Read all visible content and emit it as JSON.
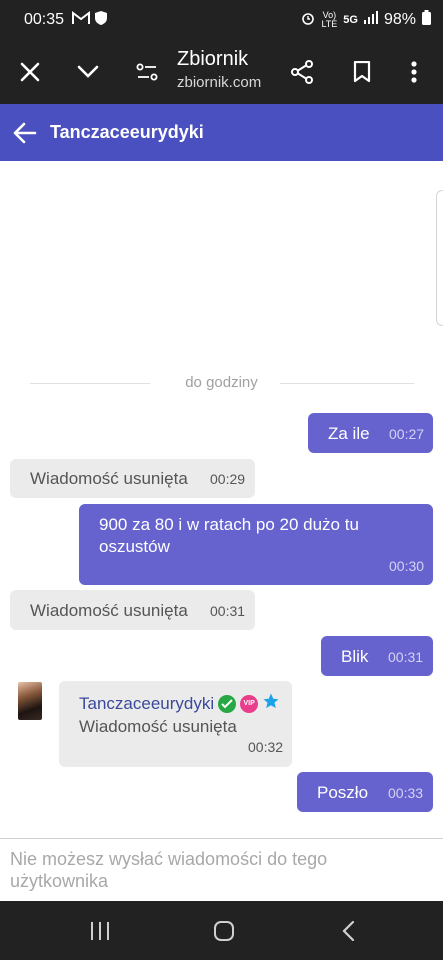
{
  "status_bar": {
    "time": "00:35",
    "network_top": "Vo)",
    "network_bottom": "LTE",
    "fiveg": "5G",
    "battery": "98%"
  },
  "browser": {
    "site_title": "Zbiornik",
    "site_url": "zbiornik.com"
  },
  "chat": {
    "title": "Tanczaceeurydyki",
    "separator_label": "do godziny",
    "messages": [
      {
        "direction": "out",
        "text": "Za ile",
        "time": "00:27"
      },
      {
        "direction": "in",
        "text": "Wiadomość usunięta",
        "time": "00:29"
      },
      {
        "direction": "out",
        "text": "900 za 80 i w ratach po 20 dużo tu oszustów",
        "time": "00:30"
      },
      {
        "direction": "in",
        "text": "Wiadomość usunięta",
        "time": "00:31"
      },
      {
        "direction": "out",
        "text": "Blik",
        "time": "00:31"
      },
      {
        "direction": "in",
        "sender": "Tanczaceeurydyki",
        "vip_label": "VIP",
        "text": "Wiadomość usunięta",
        "time": "00:32"
      },
      {
        "direction": "out",
        "text": "Poszło",
        "time": "00:33"
      }
    ],
    "footer_notice": "Nie możesz wysłać wiadomości do tego użytkownika"
  },
  "colors": {
    "header": "#4b50c0",
    "outgoing_bubble": "#6663cf",
    "incoming_bubble": "#ebebeb",
    "system_bar": "#222222"
  },
  "icons": {
    "browser": [
      "close-icon",
      "chevron-down-icon",
      "page-settings-icon",
      "share-icon",
      "bookmark-icon",
      "more-icon"
    ],
    "badges": [
      "verified-icon",
      "vip-icon",
      "star-icon"
    ],
    "nav": [
      "recent-apps-icon",
      "home-icon",
      "back-icon"
    ]
  }
}
